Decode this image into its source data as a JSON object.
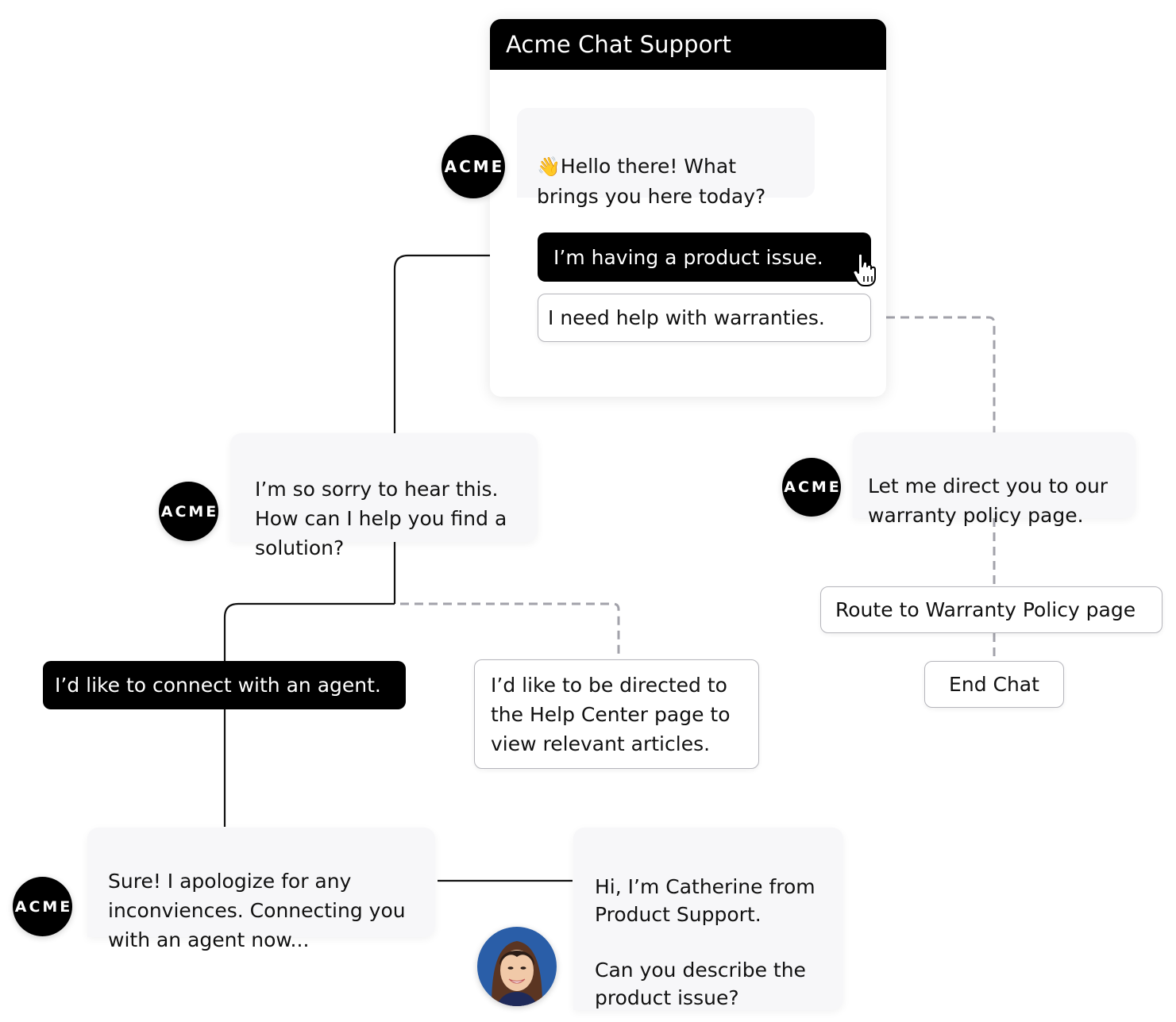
{
  "widget": {
    "title": "Acme Chat Support",
    "greeting": {
      "emoji": "👋",
      "text": "Hello there! What\nbrings you here today?"
    },
    "options": [
      {
        "label": "I’m having a product issue.",
        "selected": true
      },
      {
        "label": "I need help with warranties.",
        "selected": false
      }
    ]
  },
  "avatar_label": "ACME",
  "flow": {
    "product_issue_reply": "I’m so sorry to hear this.\nHow can I help you find a\nsolution?",
    "product_issue_options": [
      {
        "label": "I’d like to connect with an agent.",
        "selected": true
      },
      {
        "label": "I’d like to be directed to\nthe Help Center page to\nview relevant articles.",
        "selected": false
      }
    ],
    "agent_reply": "Sure! I apologize for any\ninconviences. Connecting you\nwith an agent now...",
    "agent_message": "Hi, I’m Catherine from\nProduct Support.\n\nCan you describe the\nproduct issue?",
    "warranty_reply": "Let me direct you to our\nwarranty policy page.",
    "warranty_actions": [
      {
        "label": "Route to Warranty Policy page"
      },
      {
        "label": "End Chat"
      }
    ]
  },
  "colors": {
    "primary": "#000000",
    "bubble_bg": "#f7f7f9",
    "dashed_connector": "#a2a2aa",
    "photo_bg": "#2a5ea8"
  }
}
